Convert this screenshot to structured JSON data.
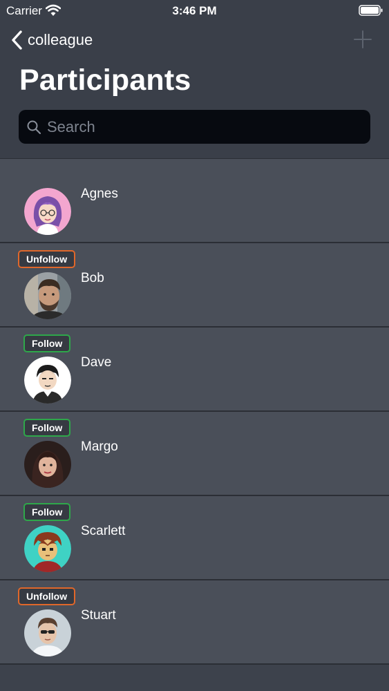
{
  "status_bar": {
    "carrier": "Carrier",
    "time": "3:46 PM"
  },
  "nav": {
    "back_label": "colleague",
    "title": "Participants"
  },
  "search": {
    "placeholder": "Search",
    "value": ""
  },
  "colors": {
    "background": "#3d424c",
    "row_background": "#4a4f59",
    "follow": "#2ea84a",
    "unfollow": "#e0672a",
    "search_field": "#070a10"
  },
  "participants": [
    {
      "name": "Agnes",
      "badge": "",
      "avatar": "agnes-avatar"
    },
    {
      "name": "Bob",
      "badge": "Unfollow",
      "avatar": "bob-avatar"
    },
    {
      "name": "Dave",
      "badge": "Follow",
      "avatar": "dave-avatar"
    },
    {
      "name": "Margo",
      "badge": "Follow",
      "avatar": "margo-avatar"
    },
    {
      "name": "Scarlett",
      "badge": "Follow",
      "avatar": "scarlett-avatar"
    },
    {
      "name": "Stuart",
      "badge": "Unfollow",
      "avatar": "stuart-avatar"
    }
  ]
}
